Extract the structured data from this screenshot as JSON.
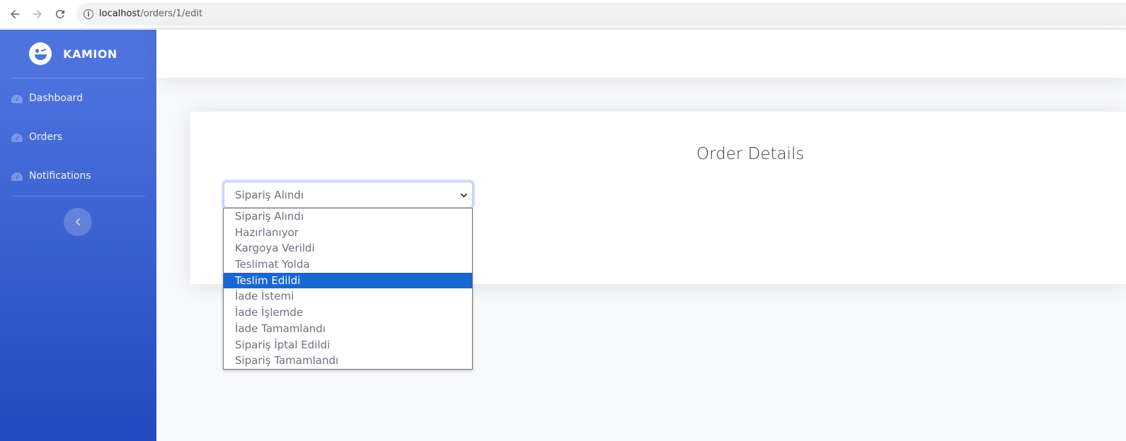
{
  "browser": {
    "url_host": "localhost",
    "url_path": "/orders/1/edit"
  },
  "sidebar": {
    "brand": "KAMION",
    "items": [
      {
        "label": "Dashboard",
        "icon": "tachometer-icon"
      },
      {
        "label": "Orders",
        "icon": "tachometer-icon"
      },
      {
        "label": "Notifications",
        "icon": "tachometer-icon"
      }
    ],
    "toggle_icon": "chevron-left-icon"
  },
  "card": {
    "title": "Order Details"
  },
  "status_select": {
    "selected_value": "Sipariş Alındı",
    "options": [
      "Sipariş Alındı",
      "Hazırlanıyor",
      "Kargoya Verildi",
      "Teslimat Yolda",
      "Teslim Edildi",
      "İade İstemi",
      "İade İşlemde",
      "İade Tamamlandı",
      "Sipariş İptal Edildi",
      "Sipariş Tamamlandı"
    ],
    "highlighted_option": "Teslim Edildi"
  },
  "colors": {
    "sidebar_top": "#4e73df",
    "sidebar_bottom": "#224abe",
    "highlight": "#1967d2"
  }
}
